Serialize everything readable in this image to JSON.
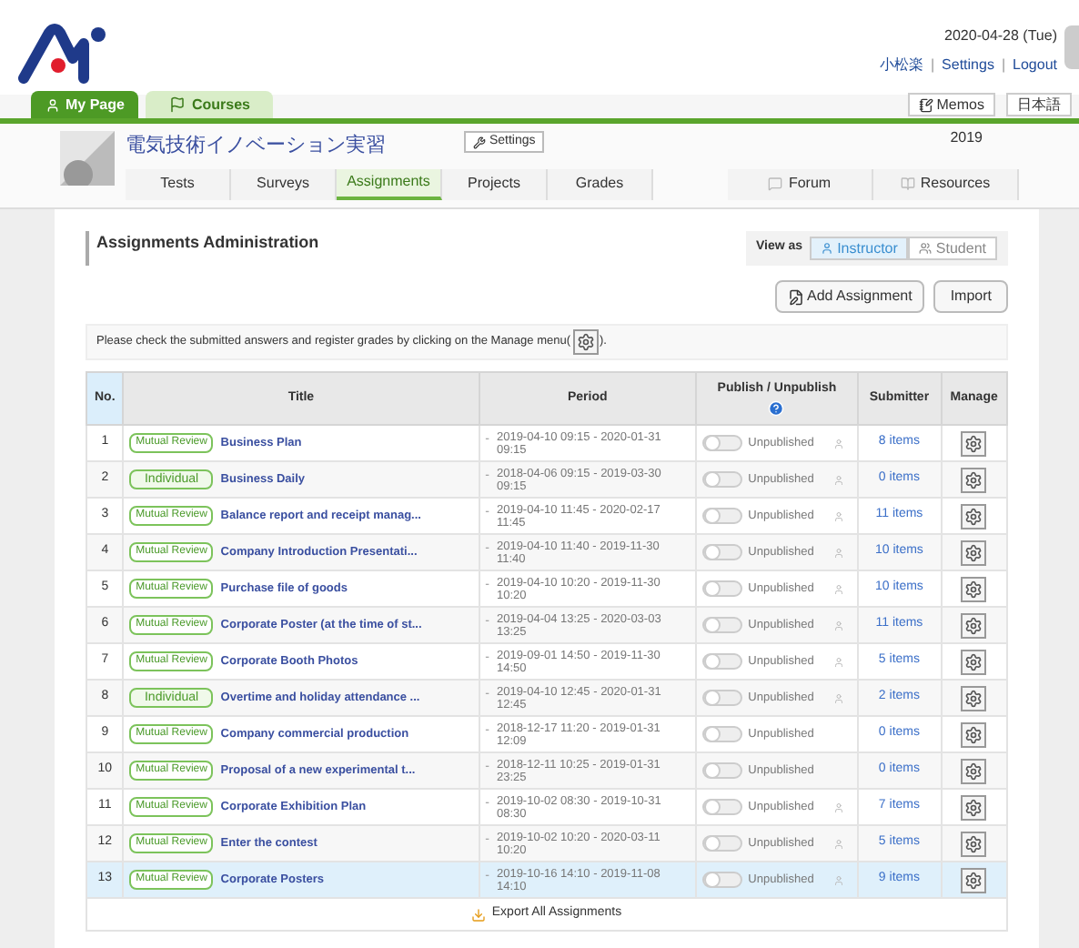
{
  "header": {
    "date": "2020-04-28 (Tue)",
    "user": "小松楽",
    "links": [
      "Settings",
      "Logout"
    ],
    "separators": [
      "|",
      "|"
    ]
  },
  "nav": {
    "tabs": [
      {
        "label": "My Page",
        "selected": true
      },
      {
        "label": "Courses",
        "selected": false
      }
    ],
    "buttons": [
      "Memos",
      "日本語"
    ]
  },
  "course": {
    "title": "電気技術イノベーション実習",
    "settings": "Settings",
    "year": "2019",
    "tabs": [
      {
        "label": "Tests",
        "selected": false
      },
      {
        "label": "Surveys",
        "selected": false
      },
      {
        "label": "Assignments",
        "selected": true
      },
      {
        "label": "Projects",
        "selected": false
      },
      {
        "label": "Grades",
        "selected": false
      }
    ],
    "side_tabs": [
      "Forum",
      "Resources"
    ]
  },
  "panel": {
    "title": "Assignments Administration",
    "view_as": "View as",
    "view_options": [
      {
        "label": "Instructor",
        "selected": true
      },
      {
        "label": "Student",
        "selected": false
      }
    ],
    "buttons": [
      "Add Assignment",
      "Import"
    ],
    "notice": "Please check the submitted answers and register grades by clicking on the Manage menu(",
    "notice_end": ")."
  },
  "table": {
    "columns": [
      "No.",
      "Title",
      "Period",
      "Publish / Unpublish",
      "Submitter",
      "Manage"
    ],
    "rows": [
      {
        "no": "1",
        "kind": "mutual",
        "tag": "Mutual Review",
        "title": "Business Plan",
        "dash": "-",
        "period": "2019-04-10 09:15 - 2020-01-31 09:15",
        "published": false,
        "status": "Unpublished",
        "user_icon": true,
        "submitter": "8 items",
        "selected": false
      },
      {
        "no": "2",
        "kind": "individual",
        "tag": "Individual",
        "title": "Business Daily",
        "dash": "-",
        "period": "2018-04-06 09:15 - 2019-03-30 09:15",
        "published": false,
        "status": "Unpublished",
        "user_icon": true,
        "submitter": "0 items",
        "selected": false
      },
      {
        "no": "3",
        "kind": "mutual",
        "tag": "Mutual Review",
        "title": "Balance report and receipt manag...",
        "dash": "-",
        "period": "2019-04-10 11:45 - 2020-02-17 11:45",
        "published": false,
        "status": "Unpublished",
        "user_icon": true,
        "submitter": "11 items",
        "selected": false
      },
      {
        "no": "4",
        "kind": "mutual",
        "tag": "Mutual Review",
        "title": "Company Introduction Presentati...",
        "dash": "-",
        "period": "2019-04-10 11:40 - 2019-11-30 11:40",
        "published": false,
        "status": "Unpublished",
        "user_icon": true,
        "submitter": "10 items",
        "selected": false
      },
      {
        "no": "5",
        "kind": "mutual",
        "tag": "Mutual Review",
        "title": "Purchase file of goods",
        "dash": "-",
        "period": "2019-04-10 10:20 - 2019-11-30 10:20",
        "published": false,
        "status": "Unpublished",
        "user_icon": true,
        "submitter": "10 items",
        "selected": false
      },
      {
        "no": "6",
        "kind": "mutual",
        "tag": "Mutual Review",
        "title": "Corporate Poster (at the time of st...",
        "dash": "-",
        "period": "2019-04-04 13:25 - 2020-03-03 13:25",
        "published": false,
        "status": "Unpublished",
        "user_icon": true,
        "submitter": "11 items",
        "selected": false
      },
      {
        "no": "7",
        "kind": "mutual",
        "tag": "Mutual Review",
        "title": "Corporate Booth Photos",
        "dash": "-",
        "period": "2019-09-01 14:50 - 2019-11-30 14:50",
        "published": false,
        "status": "Unpublished",
        "user_icon": true,
        "submitter": "5 items",
        "selected": false
      },
      {
        "no": "8",
        "kind": "individual",
        "tag": "Individual",
        "title": "Overtime and holiday attendance ...",
        "dash": "-",
        "period": "2019-04-10 12:45 - 2020-01-31 12:45",
        "published": false,
        "status": "Unpublished",
        "user_icon": true,
        "submitter": "2 items",
        "selected": false
      },
      {
        "no": "9",
        "kind": "mutual",
        "tag": "Mutual Review",
        "title": "Company commercial production",
        "dash": "-",
        "period": "2018-12-17 11:20 - 2019-01-31 12:09",
        "published": false,
        "status": "Unpublished",
        "user_icon": false,
        "submitter": "0 items",
        "selected": false
      },
      {
        "no": "10",
        "kind": "mutual",
        "tag": "Mutual Review",
        "title": "Proposal of a new experimental t...",
        "dash": "-",
        "period": "2018-12-11 10:25 - 2019-01-31 23:25",
        "published": false,
        "status": "Unpublished",
        "user_icon": false,
        "submitter": "0 items",
        "selected": false
      },
      {
        "no": "11",
        "kind": "mutual",
        "tag": "Mutual Review",
        "title": "Corporate Exhibition Plan",
        "dash": "-",
        "period": "2019-10-02 08:30 - 2019-10-31 08:30",
        "published": false,
        "status": "Unpublished",
        "user_icon": true,
        "submitter": "7 items",
        "selected": false
      },
      {
        "no": "12",
        "kind": "mutual",
        "tag": "Mutual Review",
        "title": "Enter the contest",
        "dash": "-",
        "period": "2019-10-02 10:20 - 2020-03-11 10:20",
        "published": false,
        "status": "Unpublished",
        "user_icon": true,
        "submitter": "5 items",
        "selected": false
      },
      {
        "no": "13",
        "kind": "mutual",
        "tag": "Mutual Review",
        "title": "Corporate Posters",
        "dash": "-",
        "period": "2019-10-16 14:10 - 2019-11-08 14:10",
        "published": false,
        "status": "Unpublished",
        "user_icon": true,
        "submitter": "9 items",
        "selected": true
      }
    ],
    "export": "Export All Assignments"
  }
}
